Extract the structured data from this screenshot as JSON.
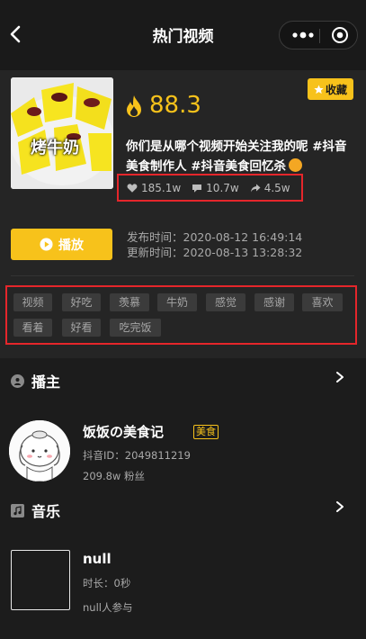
{
  "header": {
    "title": "热门视频",
    "back_icon": "chevron-left-icon",
    "more_icon": "more-dots-icon",
    "target_icon": "record-target-icon"
  },
  "video": {
    "thumbnail_text": "烤牛奶",
    "favorite_label": "收藏",
    "favorite_icon": "star-icon",
    "score": "88.3",
    "score_icon": "flame-icon",
    "description": "你们是从哪个视频开始关注我的呢 #抖音美食制作人 #抖音美食回忆杀",
    "stats": {
      "likes": "185.1w",
      "comments": "10.7w",
      "shares": "4.5w"
    },
    "play_label": "播放",
    "publish_time": "发布时间：2020-08-12 16:49:14",
    "update_time": "更新时间：2020-08-13 13:28:32",
    "tags": [
      "视频",
      "好吃",
      "羡慕",
      "牛奶",
      "感觉",
      "感谢",
      "喜欢",
      "看着",
      "好看",
      "吃完饭"
    ]
  },
  "anchor": {
    "section_title": "播主",
    "name": "饭饭の美食记",
    "badge": "美食",
    "id_text": "抖音ID：2049811219",
    "fans_text": "209.8w 粉丝"
  },
  "music": {
    "section_title": "音乐",
    "title": "null",
    "duration": "时长：0秒",
    "users": "null人参与"
  },
  "colors": {
    "accent": "#f7c21b",
    "highlight_border": "#e5262b",
    "background": "#1e1e1e"
  }
}
